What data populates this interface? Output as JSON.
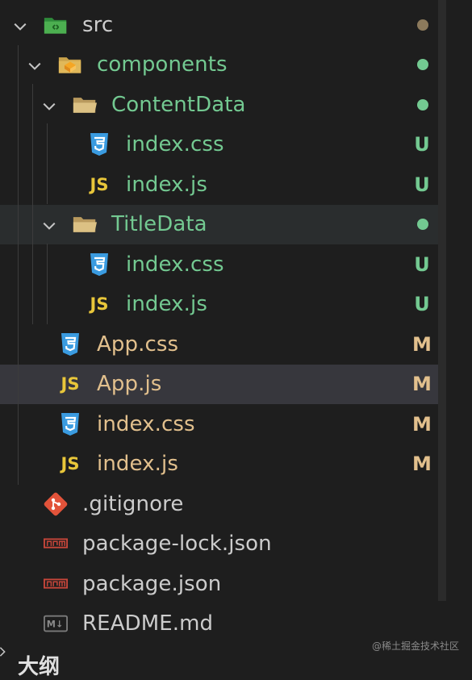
{
  "tree": {
    "src": {
      "label": "src",
      "status_color": "#8c7a5c"
    },
    "components": {
      "label": "components",
      "status_color": "#73c991"
    },
    "content_data": {
      "label": "ContentData",
      "status_color": "#73c991",
      "files": [
        {
          "label": "index.css",
          "badge": "U"
        },
        {
          "label": "index.js",
          "badge": "U"
        }
      ]
    },
    "title_data": {
      "label": "TitleData",
      "status_color": "#73c991",
      "files": [
        {
          "label": "index.css",
          "badge": "U"
        },
        {
          "label": "index.js",
          "badge": "U"
        }
      ]
    },
    "src_files": [
      {
        "label": "App.css",
        "badge": "M"
      },
      {
        "label": "App.js",
        "badge": "M"
      },
      {
        "label": "index.css",
        "badge": "M"
      },
      {
        "label": "index.js",
        "badge": "M"
      }
    ],
    "root_files": [
      {
        "label": ".gitignore"
      },
      {
        "label": "package-lock.json"
      },
      {
        "label": "package.json"
      },
      {
        "label": "README.md"
      }
    ]
  },
  "icons": {
    "js_text": "JS",
    "md_text": "M↓"
  },
  "outline": {
    "label": "大纲"
  },
  "watermark": "@稀土掘金技术社区",
  "colors": {
    "untracked": "#73c991",
    "modified": "#e2c08d",
    "css_icon": "#3a9be0",
    "js_icon": "#e8c63a",
    "git_icon": "#e2533a"
  }
}
